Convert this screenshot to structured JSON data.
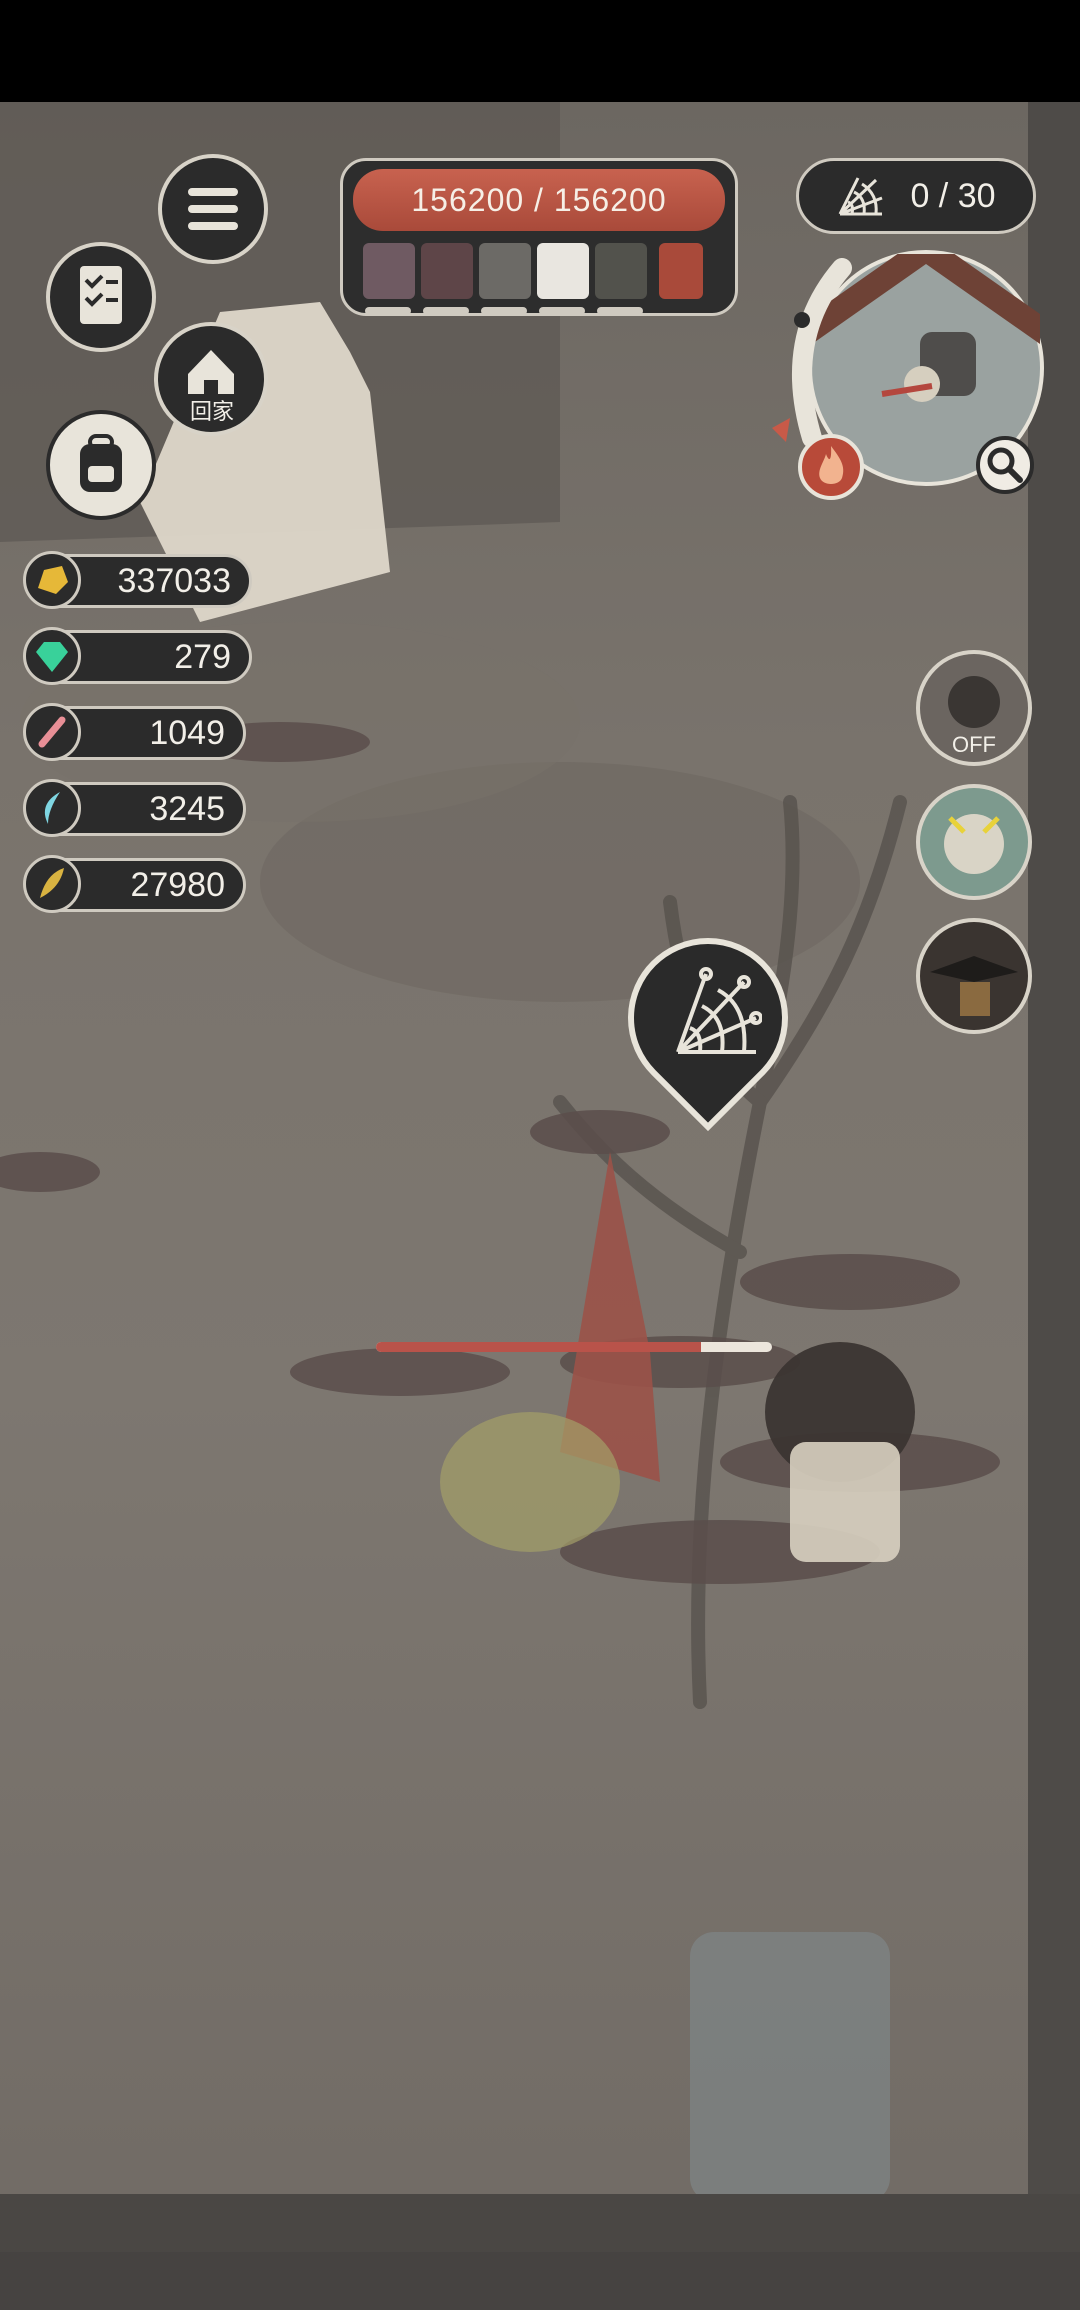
{
  "hud": {
    "menu_icon": "hamburger-menu-icon",
    "quest_icon": "checklist-icon",
    "home_label": "回家",
    "backpack_icon": "backpack-icon"
  },
  "health": {
    "text": "156200 / 156200",
    "current": 156200,
    "max": 156200
  },
  "web_counter": {
    "text": "0 / 30"
  },
  "resources": [
    {
      "name": "gold",
      "icon": "gold-nugget-icon",
      "value": "337033",
      "color": "#e6b838"
    },
    {
      "name": "gem",
      "icon": "green-gem-icon",
      "value": "279",
      "color": "#39d19a"
    },
    {
      "name": "bone",
      "icon": "bone-icon",
      "value": "1049",
      "color": "#e88f96"
    },
    {
      "name": "fang",
      "icon": "crescent-fang-icon",
      "value": "3245",
      "color": "#7fd6e2"
    },
    {
      "name": "feather",
      "icon": "feather-icon",
      "value": "27980",
      "color": "#d9b341"
    }
  ],
  "side_buttons": {
    "auto_label": "OFF"
  },
  "target_progress": 0.82,
  "colors": {
    "accent_red": "#b9534a",
    "panel": "#2b2b2b",
    "border": "#cfcac0"
  }
}
